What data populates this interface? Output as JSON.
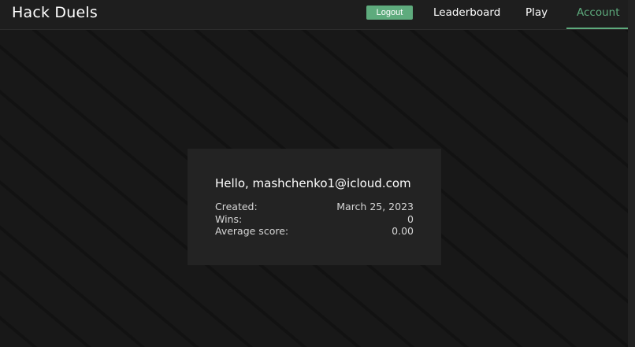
{
  "nav": {
    "brand": "Hack Duels",
    "logout_label": "Logout",
    "links": [
      {
        "label": "Leaderboard"
      },
      {
        "label": "Play"
      },
      {
        "label": "Account",
        "active": true
      }
    ],
    "accent_color": "#5eab7d"
  },
  "account": {
    "greeting": "Hello, mashchenko1@icloud.com",
    "stats": [
      {
        "label": "Created:",
        "value": "March 25, 2023"
      },
      {
        "label": "Wins:",
        "value": "0"
      },
      {
        "label": "Average score:",
        "value": "0.00"
      }
    ]
  }
}
